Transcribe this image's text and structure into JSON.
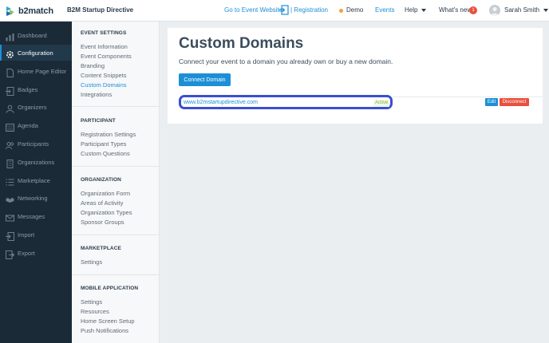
{
  "app": {
    "logo_text": "b2match",
    "event_name": "B2M Startup Directive"
  },
  "header": {
    "goto_label": "Go to Event Website",
    "registration_label": "| Registration",
    "demo_label": "Demo",
    "events_label": "Events",
    "help_label": "Help",
    "whatsnew_label": "What's new",
    "whatsnew_count": "1",
    "user_name": "Sarah Smith",
    "colors": {
      "accent": "#1d8fd6",
      "demo_dot": "#f0a33b",
      "badge": "#e8513d"
    }
  },
  "sidebar": {
    "items": [
      {
        "label": "Dashboard",
        "icon": "dashboard-icon"
      },
      {
        "label": "Configuration",
        "icon": "gear-icon",
        "active": true
      },
      {
        "label": "Home Page Editor",
        "icon": "page-icon"
      },
      {
        "label": "Badges",
        "icon": "badge-icon"
      },
      {
        "label": "Organizers",
        "icon": "user-icon"
      },
      {
        "label": "Agenda",
        "icon": "calendar-icon"
      },
      {
        "label": "Participants",
        "icon": "users-icon"
      },
      {
        "label": "Organizations",
        "icon": "building-icon"
      },
      {
        "label": "Marketplace",
        "icon": "list-icon"
      },
      {
        "label": "Networking",
        "icon": "handshake-icon"
      },
      {
        "label": "Messages",
        "icon": "envelope-icon"
      },
      {
        "label": "Import",
        "icon": "import-icon"
      },
      {
        "label": "Export",
        "icon": "export-icon"
      }
    ]
  },
  "subnav": {
    "event_settings": {
      "title": "EVENT SETTINGS",
      "links": [
        "Event Information",
        "Event Components",
        "Branding",
        "Content Snippets",
        "Custom Domains",
        "Integrations"
      ]
    },
    "participant": {
      "title": "PARTICIPANT",
      "links": [
        "Registration Settings",
        "Participant Types",
        "Custom Questions"
      ]
    },
    "organization": {
      "title": "ORGANIZATION",
      "links": [
        "Organization Form",
        "Areas of Activity",
        "Organization Types",
        "Sponsor Groups"
      ]
    },
    "marketplace": {
      "title": "MARKETPLACE",
      "links": [
        "Settings"
      ]
    },
    "mobile": {
      "title": "MOBILE APPLICATION",
      "links": [
        "Settings",
        "Resources",
        "Home Screen Setup",
        "Push Notifications"
      ]
    }
  },
  "main": {
    "title": "Custom Domains",
    "subtitle": "Connect your event to a domain you already own or buy a new domain.",
    "connect_label": "Connect Domain",
    "domain": {
      "url": "www.b2mstartupdirective.com",
      "status": "Active",
      "edit_label": "Edit",
      "disconnect_label": "Disconnect"
    }
  }
}
